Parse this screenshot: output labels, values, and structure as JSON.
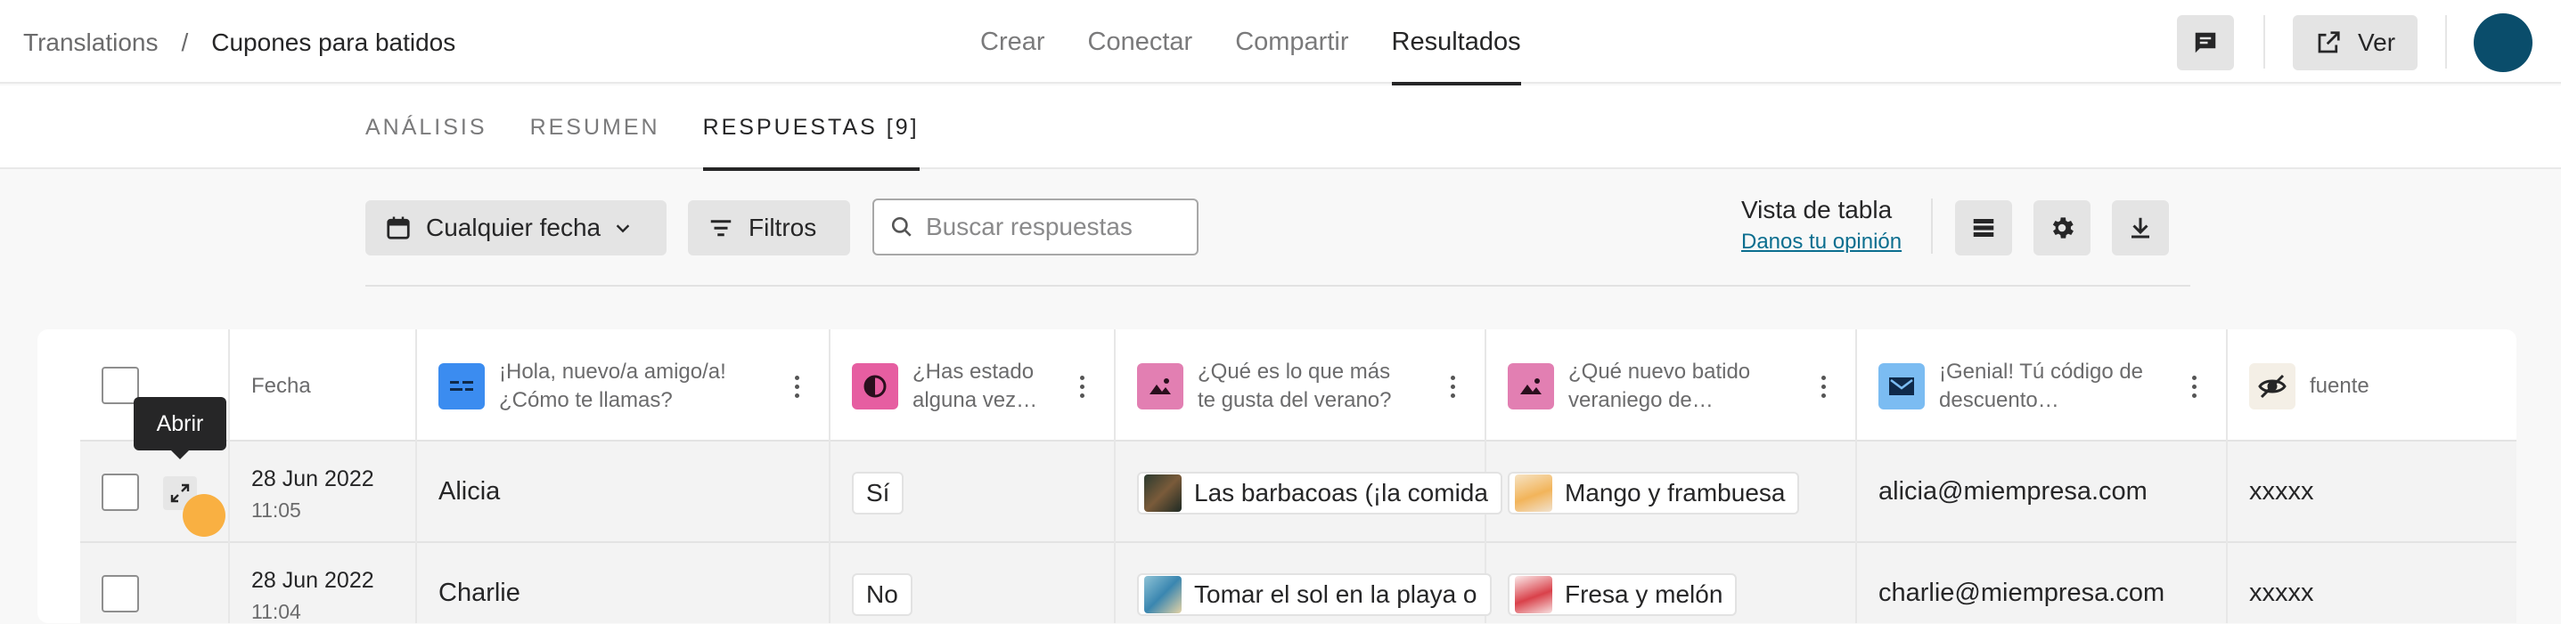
{
  "breadcrumb": {
    "root": "Translations",
    "separator": "/",
    "current": "Cupones para batidos"
  },
  "main_nav": [
    {
      "label": "Crear",
      "active": false
    },
    {
      "label": "Conectar",
      "active": false
    },
    {
      "label": "Compartir",
      "active": false
    },
    {
      "label": "Resultados",
      "active": true
    }
  ],
  "header": {
    "view_label": "Ver",
    "comments_icon": "comment-icon",
    "share_icon": "external-link-icon",
    "avatar_color": "#0a4d6b"
  },
  "sub_tabs": [
    {
      "label": "ANÁLISIS",
      "active": false
    },
    {
      "label": "RESUMEN",
      "active": false
    },
    {
      "label": "RESPUESTAS [9]",
      "active": true
    }
  ],
  "toolbar": {
    "date_filter": "Cualquier fecha",
    "filters": "Filtros",
    "search_placeholder": "Buscar respuestas",
    "table_view_title": "Vista de tabla",
    "feedback_link": "Danos tu opinión"
  },
  "table": {
    "columns": [
      {
        "key": "fecha",
        "label": "Fecha"
      },
      {
        "key": "nombre",
        "label_line1": "¡Hola, nuevo/a amigo/a!",
        "label_line2": "¿Cómo te llamas?",
        "icon": "short-text-icon",
        "icon_color": "#3b8cf0"
      },
      {
        "key": "batido",
        "label_line1": "¿Has estado",
        "label_line2": "alguna vez…",
        "icon": "yes-no-icon",
        "icon_color": "#e65ea1"
      },
      {
        "key": "verano",
        "label_line1": "¿Qué es lo que más",
        "label_line2": "te gusta del verano?",
        "icon": "picture-choice-icon",
        "icon_color": "#e27fb2"
      },
      {
        "key": "nuevo",
        "label_line1": "¿Qué nuevo batido",
        "label_line2": "veraniego de…",
        "icon": "picture-choice-icon",
        "icon_color": "#e27fb2"
      },
      {
        "key": "email",
        "label_line1": "¡Genial! Tú código de",
        "label_line2": "descuento…",
        "icon": "email-icon",
        "icon_color": "#7bbcf2"
      },
      {
        "key": "fuente",
        "label": "fuente",
        "icon": "hidden-field-icon",
        "icon_color": "#f4efe6"
      }
    ],
    "rows": [
      {
        "date": "28 Jun 2022",
        "time": "11:05",
        "nombre": "Alicia",
        "batido": "Sí",
        "verano": "Las barbacoas (¡la comida",
        "nuevo": "Mango y frambuesa",
        "email": "alicia@miempresa.com",
        "fuente": "xxxxx"
      },
      {
        "date": "28 Jun 2022",
        "time": "11:04",
        "nombre": "Charlie",
        "batido": "No",
        "verano": "Tomar el sol en la playa o",
        "nuevo": "Fresa y melón",
        "email": "charlie@miempresa.com",
        "fuente": "xxxxx"
      }
    ]
  },
  "tooltip": {
    "open_label": "Abrir"
  }
}
